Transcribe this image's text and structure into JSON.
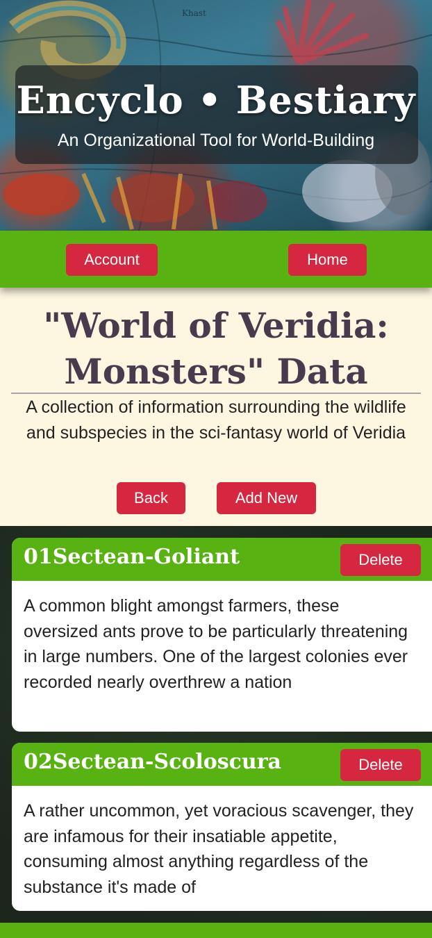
{
  "hero": {
    "title": "Encyclo • Bestiary",
    "subtitle": "An Organizational Tool for World-Building",
    "map_label": "Khast"
  },
  "nav": {
    "account_label": "Account",
    "home_label": "Home"
  },
  "page": {
    "title": "\"World of Veridia: Monsters\" Data",
    "description": "A collection of information surrounding the wildlife and subspecies in the sci-fantasy world of Veridia",
    "back_label": "Back",
    "add_new_label": "Add New"
  },
  "entries": [
    {
      "name": "01Sectean-Goliant",
      "delete_label": "Delete",
      "description": "A common blight amongst farmers, these oversized ants prove to be particularly threatening in large numbers. One of the largest colonies ever recorded nearly overthrew a nation"
    },
    {
      "name": "02Sectean-Scoloscura",
      "delete_label": "Delete",
      "description": "A rather uncommon, yet voracious scavenger, they are infamous for their insatiable appetite, consuming almost anything regardless of the substance it's made of"
    }
  ],
  "colors": {
    "accent_green": "#58b312",
    "button_red": "#d62740",
    "cream": "#fdf6e0",
    "title_purple": "#4a3a4e",
    "dark_background": "#1b261c"
  }
}
